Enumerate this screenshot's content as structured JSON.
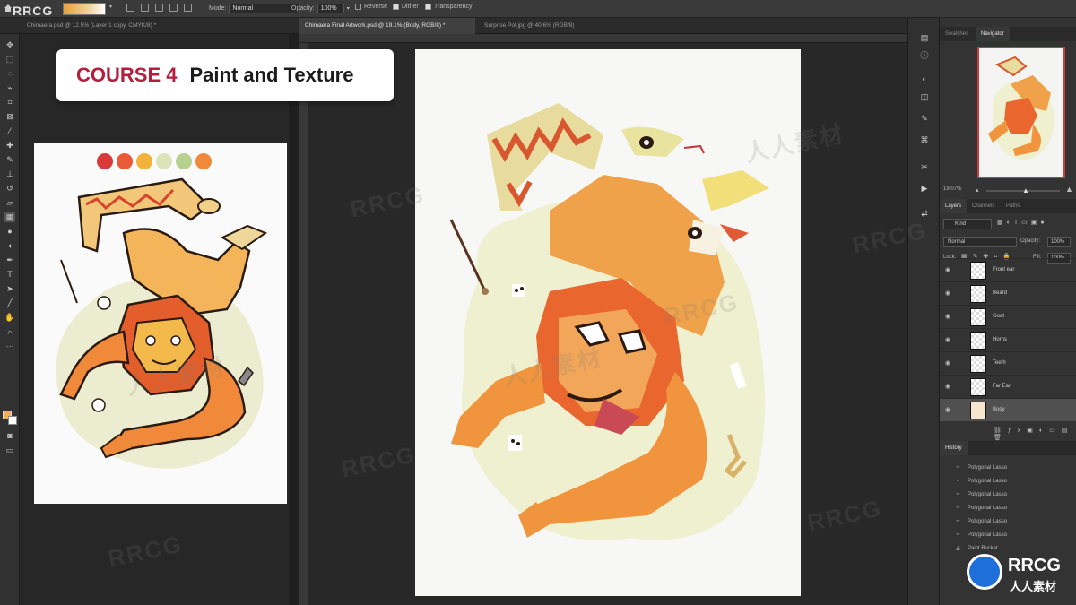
{
  "watermark": {
    "top_left": "RRCG",
    "corner_logo": "RRCG",
    "corner_logo_sub": "人人素材",
    "tile_text": "RRCG",
    "tile_text_cn": "人人素材"
  },
  "options_bar": {
    "mode_label": "Mode:",
    "mode_value": "Normal",
    "opacity_label": "Opacity:",
    "opacity_value": "100%",
    "reverse_label": "Reverse",
    "dither_label": "Dither",
    "transparency_label": "Transparency"
  },
  "tabs": [
    {
      "label": "Chimaera.psd @ 12.5% (Layer 1 copy, CMYK/8) *",
      "active": false
    },
    {
      "label": "Chimaera Final Artwork.psd @ 19.1% (Body, RGB/8) *",
      "active": true
    },
    {
      "label": "Surprise Pot.jpg @ 40.6% (RGB/8)",
      "active": false
    }
  ],
  "banner": {
    "course": "COURSE 4",
    "title": "Paint and Texture"
  },
  "palette": [
    "#d83a3a",
    "#e85a38",
    "#f2b23c",
    "#dde3b8",
    "#b8d08e",
    "#f08a3a"
  ],
  "navigator": {
    "tabs": [
      "Swatches",
      "Navigator"
    ],
    "zoom": "19.07%"
  },
  "layers_panel": {
    "tabs": [
      "Layers",
      "Channels",
      "Paths"
    ],
    "kind_label": "Kind",
    "blend_mode": "Normal",
    "opacity_label": "Opacity:",
    "opacity_value": "100%",
    "lock_label": "Lock:",
    "fill_label": "Fill:",
    "fill_value": "100%",
    "layers": [
      {
        "name": "Front ear",
        "selected": false
      },
      {
        "name": "Beard",
        "selected": false
      },
      {
        "name": "Goat",
        "selected": false
      },
      {
        "name": "Horns",
        "selected": false
      },
      {
        "name": "Teeth",
        "selected": false
      },
      {
        "name": "Far Ear",
        "selected": false
      },
      {
        "name": "Body",
        "selected": true
      }
    ]
  },
  "history_panel": {
    "title": "History",
    "items": [
      "Polygonal Lasso",
      "Polygonal Lasso",
      "Polygonal Lasso",
      "Polygonal Lasso",
      "Polygonal Lasso",
      "Polygonal Lasso",
      "Paint Bucket"
    ]
  }
}
